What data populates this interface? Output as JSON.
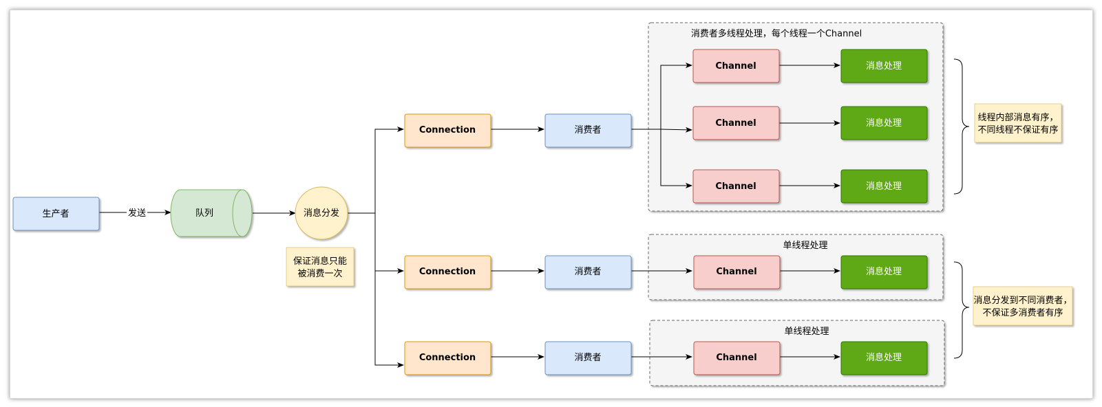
{
  "producer": {
    "label": "生产者"
  },
  "send_label": "发送",
  "queue": {
    "label": "队列"
  },
  "dispatch": {
    "label": "消息分发"
  },
  "dispatch_note": {
    "line1": "保证消息只能",
    "line2": "被消费一次"
  },
  "rows": [
    {
      "connection": "Connection",
      "consumer": "消费者",
      "group_title": "消费者多线程处理，每个线程一个Channel",
      "channels": [
        {
          "channel": "Channel",
          "handler": "消息处理"
        },
        {
          "channel": "Channel",
          "handler": "消息处理"
        },
        {
          "channel": "Channel",
          "handler": "消息处理"
        }
      ]
    },
    {
      "connection": "Connection",
      "consumer": "消费者",
      "group_title": "单线程处理",
      "channels": [
        {
          "channel": "Channel",
          "handler": "消息处理"
        }
      ]
    },
    {
      "connection": "Connection",
      "consumer": "消费者",
      "group_title": "单线程处理",
      "channels": [
        {
          "channel": "Channel",
          "handler": "消息处理"
        }
      ]
    }
  ],
  "notes": [
    {
      "line1": "线程内部消息有序，",
      "line2": "不同线程不保证有序"
    },
    {
      "line1": "消息分发到不同消费者，",
      "line2": "不保证多消费者有序"
    }
  ],
  "colors": {
    "blue_fill": "#dae8fc",
    "blue_stroke": "#6c8ebf",
    "green_fill": "#d5e8d4",
    "green_stroke": "#82b366",
    "yellow_fill": "#fff2cc",
    "yellow_stroke": "#d6b656",
    "orange_fill": "#ffe6cc",
    "orange_stroke": "#d79b00",
    "red_fill": "#f8cecc",
    "red_stroke": "#b85450",
    "dark_green_fill": "#60a917",
    "dark_green_stroke": "#2d7600",
    "group_fill": "#f5f5f5",
    "group_stroke": "#666666"
  }
}
